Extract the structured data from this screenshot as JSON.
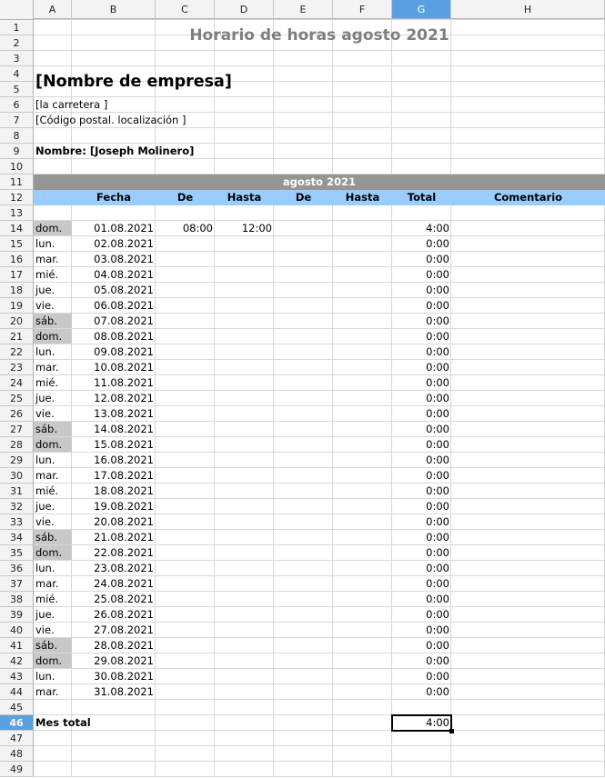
{
  "sheet": {
    "columns": [
      "A",
      "B",
      "C",
      "D",
      "E",
      "F",
      "G",
      "H"
    ],
    "selected_column": "G",
    "selected_row": "46",
    "title": "Horario de horas agosto 2021",
    "company": "[Nombre de empresa]",
    "street": "[la carretera ]",
    "postal": "[Código postal. localización ]",
    "name": "Nombre: [Joseph Molinero]",
    "month_header": "agosto 2021",
    "headers": {
      "fecha": "Fecha",
      "de1": "De",
      "hasta1": "Hasta",
      "de2": "De",
      "hasta2": "Hasta",
      "total": "Total",
      "comentario": "Comentario"
    },
    "days": [
      {
        "day": "dom.",
        "date": "01.08.2021",
        "from": "08:00",
        "to": "12:00",
        "total": "4:00",
        "weekend": true
      },
      {
        "day": "lun.",
        "date": "02.08.2021",
        "from": "",
        "to": "",
        "total": "0:00",
        "weekend": false
      },
      {
        "day": "mar.",
        "date": "03.08.2021",
        "from": "",
        "to": "",
        "total": "0:00",
        "weekend": false
      },
      {
        "day": "mié.",
        "date": "04.08.2021",
        "from": "",
        "to": "",
        "total": "0:00",
        "weekend": false
      },
      {
        "day": "jue.",
        "date": "05.08.2021",
        "from": "",
        "to": "",
        "total": "0:00",
        "weekend": false
      },
      {
        "day": "vie.",
        "date": "06.08.2021",
        "from": "",
        "to": "",
        "total": "0:00",
        "weekend": false
      },
      {
        "day": "sáb.",
        "date": "07.08.2021",
        "from": "",
        "to": "",
        "total": "0:00",
        "weekend": true
      },
      {
        "day": "dom.",
        "date": "08.08.2021",
        "from": "",
        "to": "",
        "total": "0:00",
        "weekend": true
      },
      {
        "day": "lun.",
        "date": "09.08.2021",
        "from": "",
        "to": "",
        "total": "0:00",
        "weekend": false
      },
      {
        "day": "mar.",
        "date": "10.08.2021",
        "from": "",
        "to": "",
        "total": "0:00",
        "weekend": false
      },
      {
        "day": "mié.",
        "date": "11.08.2021",
        "from": "",
        "to": "",
        "total": "0:00",
        "weekend": false
      },
      {
        "day": "jue.",
        "date": "12.08.2021",
        "from": "",
        "to": "",
        "total": "0:00",
        "weekend": false
      },
      {
        "day": "vie.",
        "date": "13.08.2021",
        "from": "",
        "to": "",
        "total": "0:00",
        "weekend": false
      },
      {
        "day": "sáb.",
        "date": "14.08.2021",
        "from": "",
        "to": "",
        "total": "0:00",
        "weekend": true
      },
      {
        "day": "dom.",
        "date": "15.08.2021",
        "from": "",
        "to": "",
        "total": "0:00",
        "weekend": true
      },
      {
        "day": "lun.",
        "date": "16.08.2021",
        "from": "",
        "to": "",
        "total": "0:00",
        "weekend": false
      },
      {
        "day": "mar.",
        "date": "17.08.2021",
        "from": "",
        "to": "",
        "total": "0:00",
        "weekend": false
      },
      {
        "day": "mié.",
        "date": "18.08.2021",
        "from": "",
        "to": "",
        "total": "0:00",
        "weekend": false
      },
      {
        "day": "jue.",
        "date": "19.08.2021",
        "from": "",
        "to": "",
        "total": "0:00",
        "weekend": false
      },
      {
        "day": "vie.",
        "date": "20.08.2021",
        "from": "",
        "to": "",
        "total": "0:00",
        "weekend": false
      },
      {
        "day": "sáb.",
        "date": "21.08.2021",
        "from": "",
        "to": "",
        "total": "0:00",
        "weekend": true
      },
      {
        "day": "dom.",
        "date": "22.08.2021",
        "from": "",
        "to": "",
        "total": "0:00",
        "weekend": true
      },
      {
        "day": "lun.",
        "date": "23.08.2021",
        "from": "",
        "to": "",
        "total": "0:00",
        "weekend": false
      },
      {
        "day": "mar.",
        "date": "24.08.2021",
        "from": "",
        "to": "",
        "total": "0:00",
        "weekend": false
      },
      {
        "day": "mié.",
        "date": "25.08.2021",
        "from": "",
        "to": "",
        "total": "0:00",
        "weekend": false
      },
      {
        "day": "jue.",
        "date": "26.08.2021",
        "from": "",
        "to": "",
        "total": "0:00",
        "weekend": false
      },
      {
        "day": "vie.",
        "date": "27.08.2021",
        "from": "",
        "to": "",
        "total": "0:00",
        "weekend": false
      },
      {
        "day": "sáb.",
        "date": "28.08.2021",
        "from": "",
        "to": "",
        "total": "0:00",
        "weekend": true
      },
      {
        "day": "dom.",
        "date": "29.08.2021",
        "from": "",
        "to": "",
        "total": "0:00",
        "weekend": true
      },
      {
        "day": "lun.",
        "date": "30.08.2021",
        "from": "",
        "to": "",
        "total": "0:00",
        "weekend": false
      },
      {
        "day": "mar.",
        "date": "31.08.2021",
        "from": "",
        "to": "",
        "total": "0:00",
        "weekend": false
      }
    ],
    "month_total_label": "Mes total",
    "month_total_value": "4:00",
    "colors": {
      "header_blue": "#99ccff",
      "month_gray": "#959595",
      "weekend_gray": "#c8c8c8",
      "title_gray": "#7f7f7f",
      "selection": "#5aa0e0"
    }
  }
}
